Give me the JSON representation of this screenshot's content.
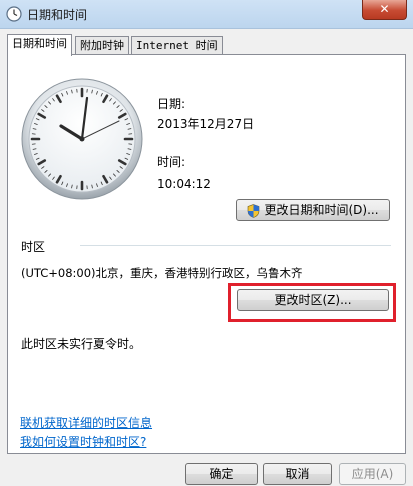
{
  "window": {
    "title": "日期和时间",
    "close_glyph": "✕"
  },
  "tabs": [
    {
      "label": "日期和时间",
      "active": true
    },
    {
      "label": "附加时钟",
      "active": false
    },
    {
      "label": "Internet 时间",
      "active": false
    }
  ],
  "date_time": {
    "date_label": "日期:",
    "date_value": "2013年12月27日",
    "time_label": "时间:",
    "time_value": "10:04:12",
    "change_button": "更改日期和时间(D)..."
  },
  "timezone": {
    "section_label": "时区",
    "value": "(UTC+08:00)北京，重庆，香港特别行政区，乌鲁木齐",
    "change_button": "更改时区(Z)...",
    "dst_note": "此时区未实行夏令时。"
  },
  "links": {
    "online_info": "联机获取详细的时区信息",
    "how_to": "我如何设置时钟和时区?"
  },
  "footer": {
    "ok": "确定",
    "cancel": "取消",
    "apply": "应用(A)"
  },
  "colors": {
    "highlight": "#e0202c",
    "link": "#0066cc"
  },
  "icons": {
    "window": "clock-window-icon",
    "uac": "uac-shield-icon"
  }
}
